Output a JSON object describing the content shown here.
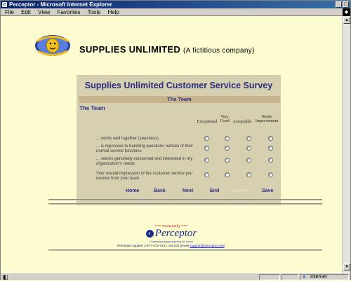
{
  "window": {
    "title": "Perceptor - Microsoft Internet Explorer",
    "controls": [
      "_",
      "□"
    ]
  },
  "menu": [
    "File",
    "Edit",
    "View",
    "Favorites",
    "Tools",
    "Help"
  ],
  "brand": {
    "name": "SUPPLIES UNLIMITED",
    "tagline": "(A fictitious company)"
  },
  "survey": {
    "title": "Supplies Unlimited Customer Service Survey",
    "section_bar": "The Team",
    "section_heading": "The Team",
    "columns": [
      "Exceptional",
      "Very Good",
      "Acceptable",
      "Needs Improvement"
    ],
    "questions": [
      "... works well together (seamless)",
      "... is reponsive to handling questions outside of their normal service functions",
      "... seems genuinely concerned and interested in my organization's needs",
      "Your overall impression of the customer service you receive from your team"
    ]
  },
  "nav": {
    "home": "Home",
    "back": "Back",
    "next": "Next",
    "end": "End",
    "disabled": "Submit",
    "save": "Save"
  },
  "footer": {
    "powered_by": "***** Powered by *****",
    "product": "Perceptor",
    "tagline": "Communicating perceptions for action",
    "support": "Perceptor support 1-877-473-7237, ext 102 (email",
    "email": "support@perceptor.com",
    "support_end": ")"
  },
  "status": {
    "zone": "Internet"
  }
}
